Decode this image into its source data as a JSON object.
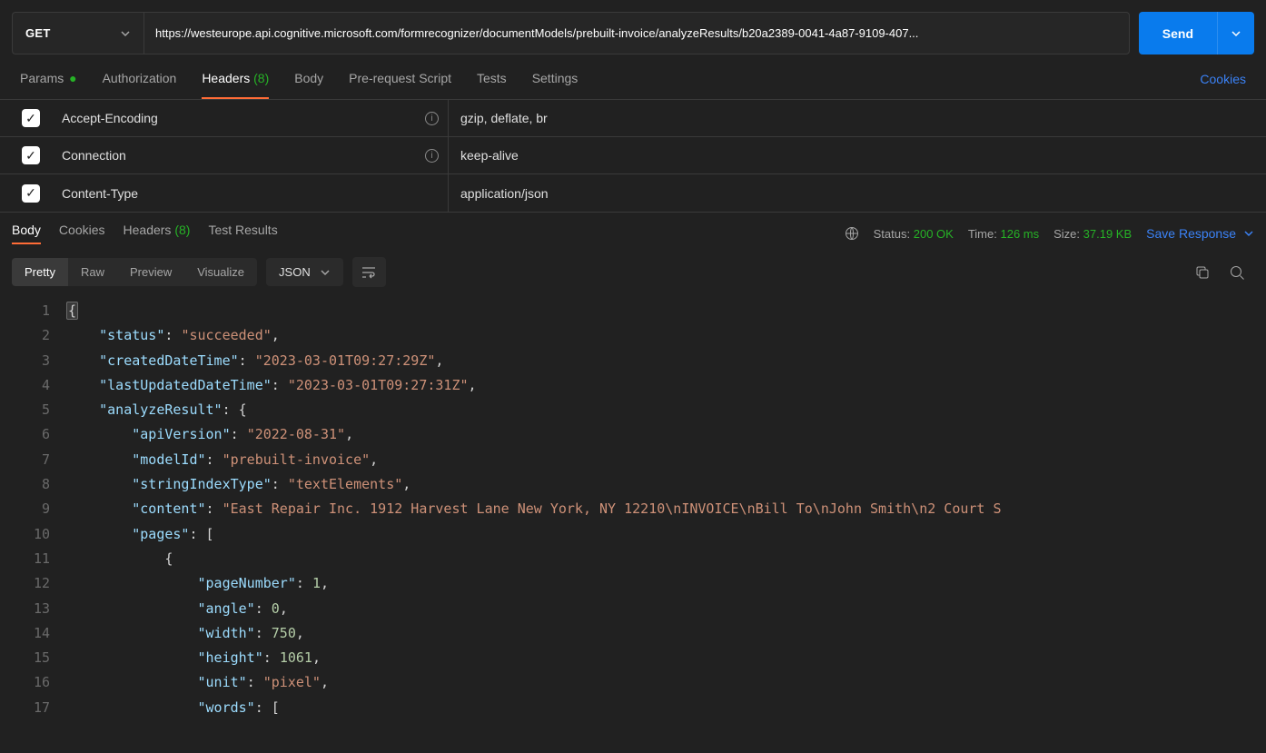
{
  "request": {
    "method": "GET",
    "url": "https://westeurope.api.cognitive.microsoft.com/formrecognizer/documentModels/prebuilt-invoice/analyzeResults/b20a2389-0041-4a87-9109-407...",
    "send_label": "Send"
  },
  "tabs": {
    "params": "Params",
    "authorization": "Authorization",
    "headers": "Headers",
    "headers_count": "(8)",
    "body": "Body",
    "prerequest": "Pre-request Script",
    "tests": "Tests",
    "settings": "Settings",
    "cookies": "Cookies"
  },
  "headers_rows": [
    {
      "key": "Accept-Encoding",
      "value": "gzip, deflate, br",
      "info": true
    },
    {
      "key": "Connection",
      "value": "keep-alive",
      "info": true
    },
    {
      "key": "Content-Type",
      "value": "application/json",
      "info": false
    }
  ],
  "response": {
    "tabs": {
      "body": "Body",
      "cookies": "Cookies",
      "headers": "Headers",
      "headers_count": "(8)",
      "test_results": "Test Results"
    },
    "status_label": "Status:",
    "status_value": "200 OK",
    "time_label": "Time:",
    "time_value": "126 ms",
    "size_label": "Size:",
    "size_value": "37.19 KB",
    "save": "Save Response"
  },
  "body_views": {
    "pretty": "Pretty",
    "raw": "Raw",
    "preview": "Preview",
    "visualize": "Visualize",
    "format": "JSON"
  },
  "code": {
    "lines": [
      "1",
      "2",
      "3",
      "4",
      "5",
      "6",
      "7",
      "8",
      "9",
      "10",
      "11",
      "12",
      "13",
      "14",
      "15",
      "16",
      "17"
    ],
    "json": {
      "status_k": "\"status\"",
      "status_v": "\"succeeded\"",
      "created_k": "\"createdDateTime\"",
      "created_v": "\"2023-03-01T09:27:29Z\"",
      "updated_k": "\"lastUpdatedDateTime\"",
      "updated_v": "\"2023-03-01T09:27:31Z\"",
      "analyze_k": "\"analyzeResult\"",
      "apiv_k": "\"apiVersion\"",
      "apiv_v": "\"2022-08-31\"",
      "model_k": "\"modelId\"",
      "model_v": "\"prebuilt-invoice\"",
      "sit_k": "\"stringIndexType\"",
      "sit_v": "\"textElements\"",
      "content_k": "\"content\"",
      "content_v": "\"East Repair Inc. 1912 Harvest Lane New York, NY 12210\\nINVOICE\\nBill To\\nJohn Smith\\n2 Court S",
      "pages_k": "\"pages\"",
      "pn_k": "\"pageNumber\"",
      "pn_v": "1",
      "angle_k": "\"angle\"",
      "angle_v": "0",
      "width_k": "\"width\"",
      "width_v": "750",
      "height_k": "\"height\"",
      "height_v": "1061",
      "unit_k": "\"unit\"",
      "unit_v": "\"pixel\"",
      "words_k": "\"words\""
    }
  }
}
